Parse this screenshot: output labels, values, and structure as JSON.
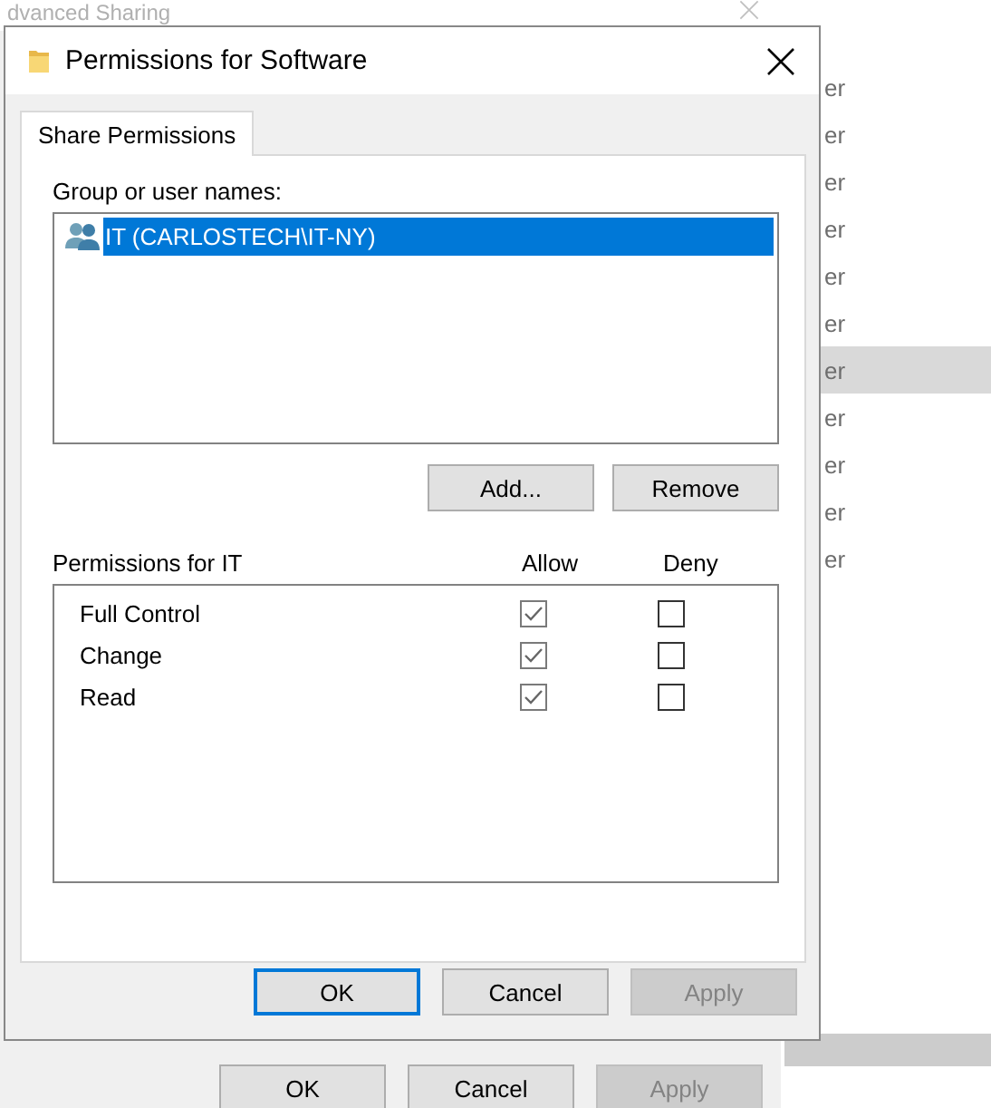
{
  "background_window": {
    "title": "dvanced Sharing",
    "buttons": [
      {
        "label": "OK",
        "disabled": false
      },
      {
        "label": "Cancel",
        "disabled": false
      },
      {
        "label": "Apply",
        "disabled": true
      }
    ]
  },
  "explorer_list": {
    "items": [
      {
        "text": "er",
        "selected": false
      },
      {
        "text": "er",
        "selected": false
      },
      {
        "text": "er",
        "selected": false
      },
      {
        "text": "er",
        "selected": false
      },
      {
        "text": "er",
        "selected": false
      },
      {
        "text": "er",
        "selected": false
      },
      {
        "text": "er",
        "selected": true
      },
      {
        "text": "er",
        "selected": false
      },
      {
        "text": "er",
        "selected": false
      },
      {
        "text": "er",
        "selected": false
      },
      {
        "text": "er",
        "selected": false
      }
    ]
  },
  "dialog": {
    "title": "Permissions for Software",
    "tabs": [
      {
        "label": "Share Permissions",
        "selected": true
      }
    ],
    "group_label": "Group or user names:",
    "principals": [
      {
        "name": "IT (CARLOSTECH\\IT-NY)",
        "selected": true
      }
    ],
    "principal_buttons": [
      {
        "label": "Add..."
      },
      {
        "label": "Remove"
      }
    ],
    "permissions_label": "Permissions for IT",
    "columns": [
      "Allow",
      "Deny"
    ],
    "permissions": [
      {
        "name": "Full Control",
        "allow": true,
        "deny": false
      },
      {
        "name": "Change",
        "allow": true,
        "deny": false
      },
      {
        "name": "Read",
        "allow": true,
        "deny": false
      }
    ],
    "buttons": [
      {
        "label": "OK",
        "default": true,
        "disabled": false
      },
      {
        "label": "Cancel",
        "default": false,
        "disabled": false
      },
      {
        "label": "Apply",
        "default": false,
        "disabled": true
      }
    ]
  }
}
